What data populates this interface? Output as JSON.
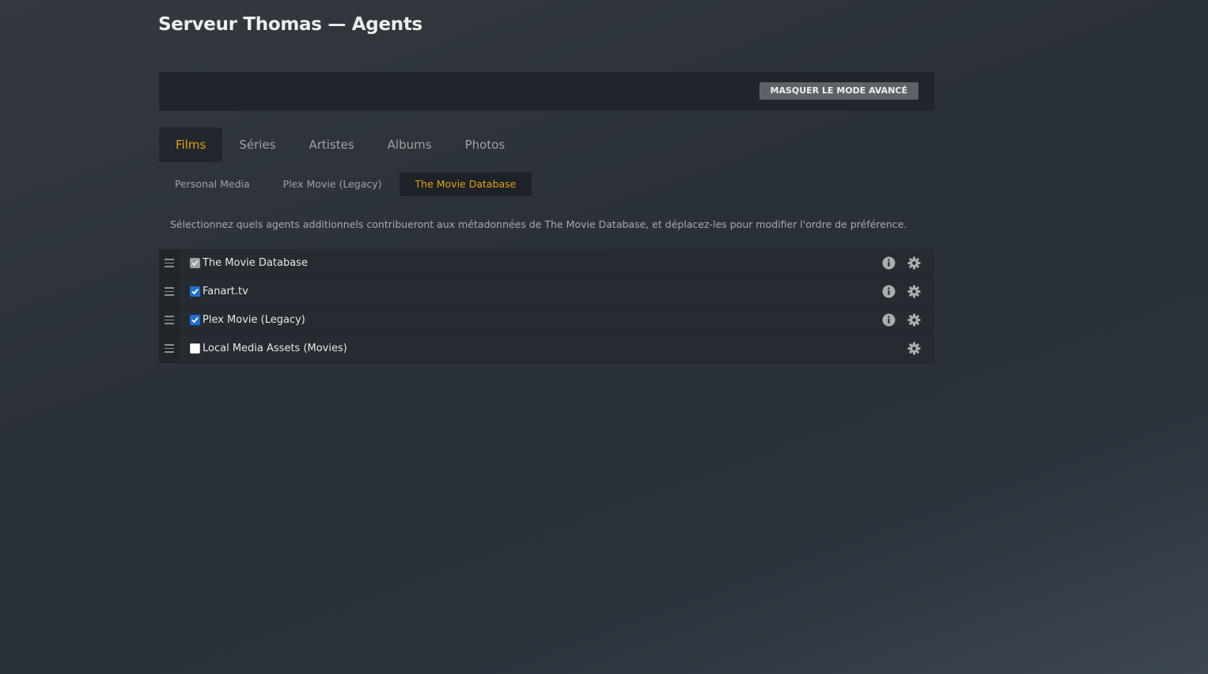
{
  "page": {
    "title": "Serveur Thomas — Agents"
  },
  "toolbar": {
    "advanced_button": "MASQUER LE MODE AVANCÉ"
  },
  "tabs": [
    {
      "label": "Films",
      "active": true
    },
    {
      "label": "Séries",
      "active": false
    },
    {
      "label": "Artistes",
      "active": false
    },
    {
      "label": "Albums",
      "active": false
    },
    {
      "label": "Photos",
      "active": false
    }
  ],
  "subtabs": [
    {
      "label": "Personal Media",
      "active": false
    },
    {
      "label": "Plex Movie (Legacy)",
      "active": false
    },
    {
      "label": "The Movie Database",
      "active": true
    }
  ],
  "description": "Sélectionnez quels agents additionnels contribueront aux métadonnées de The Movie Database, et déplacez-les pour modifier l'ordre de préférence.",
  "agents": [
    {
      "name": "The Movie Database",
      "checkbox": "checked-disabled",
      "has_info": true,
      "has_settings": true
    },
    {
      "name": "Fanart.tv",
      "checkbox": "checked",
      "has_info": true,
      "has_settings": true
    },
    {
      "name": "Plex Movie (Legacy)",
      "checkbox": "checked",
      "has_info": true,
      "has_settings": true
    },
    {
      "name": "Local Media Assets (Movies)",
      "checkbox": "unchecked",
      "has_info": false,
      "has_settings": true
    }
  ],
  "icons": {
    "drag": "drag-handle-icon",
    "info": "info-icon",
    "settings": "gear-icon"
  },
  "colors": {
    "accent": "#e5a00d",
    "checkbox_checked": "#1f6fd1",
    "checkbox_disabled": "#9ba0a6"
  }
}
